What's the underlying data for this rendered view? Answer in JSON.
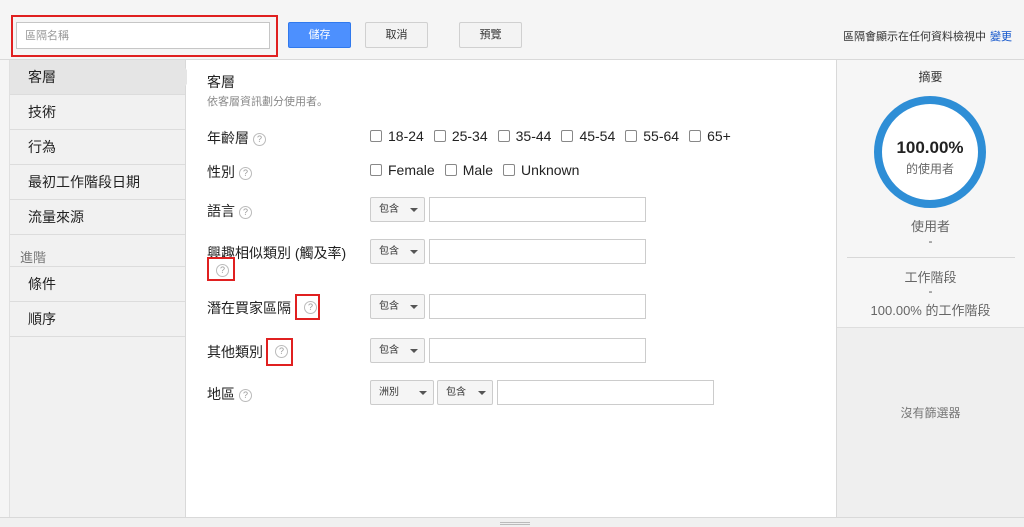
{
  "topbar": {
    "segment_name_placeholder": "區隔名稱",
    "save_label": "儲存",
    "cancel_label": "取消",
    "preview_label": "預覽",
    "visibility_text": "區隔會顯示在任何資料檢視中",
    "change_label": "變更"
  },
  "sidebar": {
    "items": [
      {
        "label": "客層"
      },
      {
        "label": "技術"
      },
      {
        "label": "行為"
      },
      {
        "label": "最初工作階段日期"
      },
      {
        "label": "流量來源"
      }
    ],
    "advanced_heading": "進階",
    "advanced_items": [
      {
        "label": "條件"
      },
      {
        "label": "順序"
      }
    ]
  },
  "main": {
    "title": "客層",
    "description": "依客層資訊劃分使用者。",
    "age": {
      "label": "年齡層",
      "options": [
        "18-24",
        "25-34",
        "35-44",
        "45-54",
        "55-64",
        "65+"
      ]
    },
    "gender": {
      "label": "性別",
      "options": [
        "Female",
        "Male",
        "Unknown"
      ]
    },
    "language": {
      "label": "語言",
      "operator": "包含"
    },
    "affinity": {
      "label": "興趣相似類別 (觸及率)",
      "operator": "包含"
    },
    "in_market": {
      "label": "潛在買家區隔",
      "operator": "包含"
    },
    "other": {
      "label": "其他類別",
      "operator": "包含"
    },
    "location": {
      "label": "地區",
      "scope": "洲別",
      "operator": "包含"
    },
    "help_glyph": "?"
  },
  "summary": {
    "title": "摘要",
    "percent": "100.00%",
    "percent_sub": "的使用者",
    "users_label": "使用者",
    "users_value": "-",
    "sessions_label": "工作階段",
    "sessions_value": "-",
    "sessions_pct": "100.00% 的工作階段",
    "no_filter": "沒有篩選器"
  }
}
